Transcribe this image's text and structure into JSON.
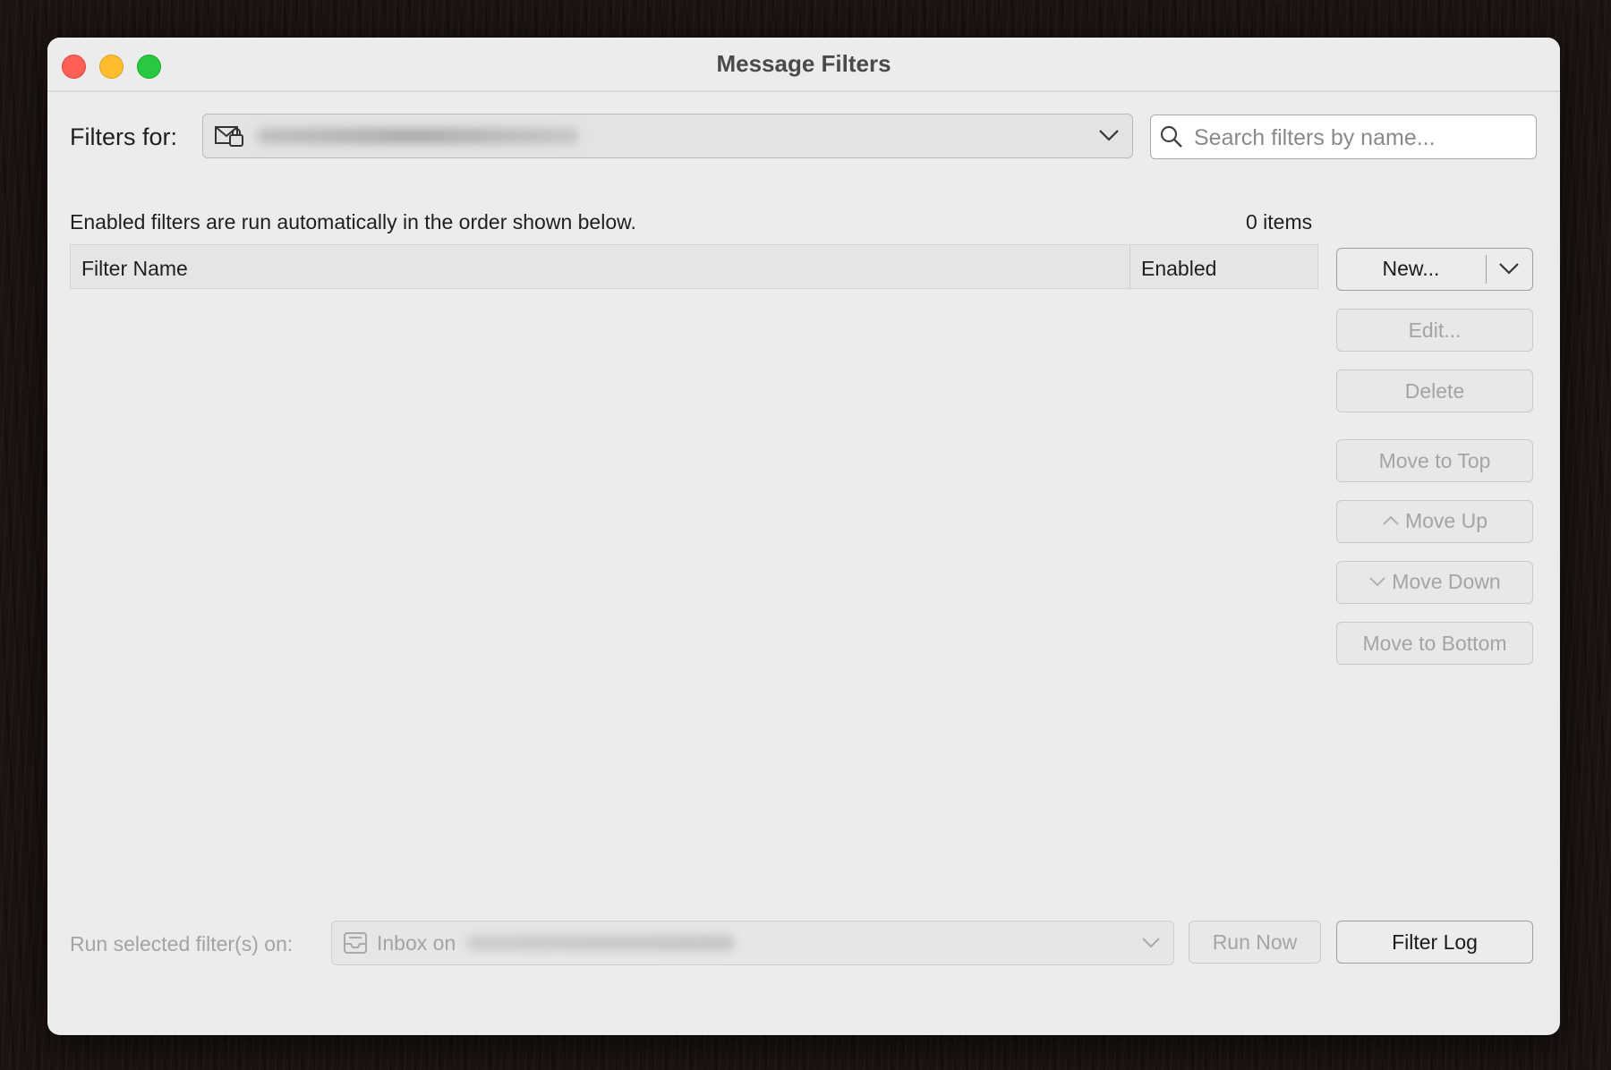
{
  "window": {
    "title": "Message Filters"
  },
  "filters_for": {
    "label": "Filters for:",
    "account_icon": "account-icon"
  },
  "search": {
    "placeholder": "Search filters by name..."
  },
  "list": {
    "description": "Enabled filters are run automatically in the order shown below.",
    "count": "0 items",
    "columns": [
      "Filter Name",
      "Enabled"
    ],
    "rows": []
  },
  "buttons": {
    "new": "New...",
    "edit": "Edit...",
    "delete": "Delete",
    "move_to_top": "Move to Top",
    "move_up": "Move Up",
    "move_down": "Move Down",
    "move_to_bottom": "Move to Bottom"
  },
  "footer": {
    "run_label": "Run selected filter(s) on:",
    "folder_prefix": "Inbox on",
    "run_now": "Run Now",
    "filter_log": "Filter Log"
  },
  "colors": {
    "close": "#fe5f57",
    "minimize": "#febc2e",
    "maximize": "#28c840"
  }
}
